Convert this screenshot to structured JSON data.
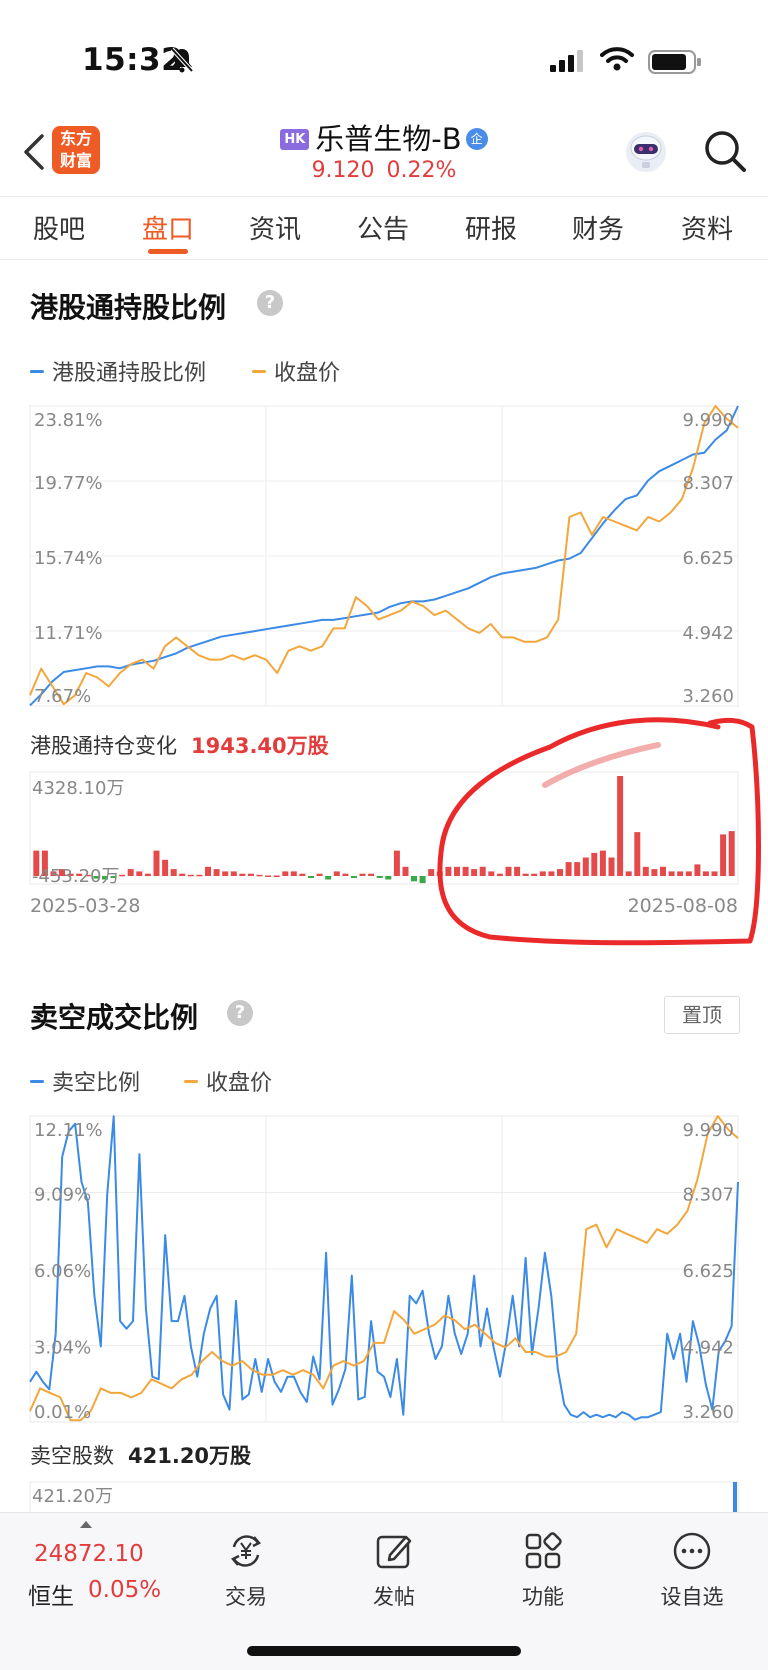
{
  "status_bar": {
    "time": "15:32"
  },
  "header": {
    "logo_text": "东方财富",
    "logo_line1": "东方",
    "logo_line2": "财富",
    "hk_badge": "HK",
    "stock_name": "乐普生物-B",
    "corp_badge": "企",
    "price": "9.120",
    "change_pct": "0.22%"
  },
  "tabs": [
    "股吧",
    "盘口",
    "资讯",
    "公告",
    "研报",
    "财务",
    "资料"
  ],
  "active_tab": 1,
  "section1": {
    "title": "港股通持股比例",
    "help": "?",
    "legend": [
      {
        "label": "港股通持股比例",
        "color": "#3b8ae6"
      },
      {
        "label": "收盘价",
        "color": "#f3a63b"
      }
    ],
    "y_left": [
      "23.81%",
      "19.77%",
      "15.74%",
      "11.71%",
      "7.67%"
    ],
    "y_right": [
      "9.990",
      "8.307",
      "6.625",
      "4.942",
      "3.260"
    ],
    "change_label": "港股通持仓变化",
    "change_value": "1943.40万股",
    "bar_max_label": "4328.10万",
    "bar_min_label": "-453.20万",
    "date_start": "2025-03-28",
    "date_end": "2025-08-08"
  },
  "section2": {
    "title": "卖空成交比例",
    "help": "?",
    "pin_button": "置顶",
    "legend": [
      {
        "label": "卖空比例",
        "color": "#3b8ae6"
      },
      {
        "label": "收盘价",
        "color": "#f3a63b"
      }
    ],
    "y_left": [
      "12.11%",
      "9.09%",
      "6.06%",
      "3.04%",
      "0.01%"
    ],
    "y_right": [
      "9.990",
      "8.307",
      "6.625",
      "4.942",
      "3.260"
    ],
    "shares_label": "卖空股数",
    "shares_value": "421.20万股",
    "bar_max_label": "421.20万"
  },
  "bottom_bar": {
    "index_value": "24872.10",
    "index_name": "恒生",
    "index_pct": "0.05%",
    "nav": [
      {
        "label": "交易",
        "icon": "yuan-exchange-icon"
      },
      {
        "label": "发帖",
        "icon": "edit-post-icon"
      },
      {
        "label": "功能",
        "icon": "grid-apps-icon"
      },
      {
        "label": "设自选",
        "icon": "more-dots-icon"
      }
    ]
  },
  "chart_data": [
    {
      "type": "line",
      "title": "港股通持股比例",
      "x_start": "2025-03-28",
      "x_end": "2025-08-08",
      "y_left_range": [
        7.67,
        23.81
      ],
      "y_right_range": [
        3.26,
        9.99
      ],
      "grid": true,
      "series": [
        {
          "name": "港股通持股比例",
          "axis": "left",
          "values": [
            7.7,
            8.3,
            9.0,
            9.5,
            9.6,
            9.7,
            9.8,
            9.8,
            9.7,
            9.9,
            10.0,
            10.1,
            10.3,
            10.5,
            10.8,
            11.0,
            11.2,
            11.4,
            11.5,
            11.6,
            11.7,
            11.8,
            11.9,
            12.0,
            12.1,
            12.2,
            12.3,
            12.3,
            12.4,
            12.5,
            12.6,
            12.7,
            13.0,
            13.2,
            13.3,
            13.3,
            13.4,
            13.6,
            13.8,
            14.0,
            14.3,
            14.6,
            14.8,
            14.9,
            15.0,
            15.1,
            15.3,
            15.5,
            15.6,
            15.9,
            16.7,
            17.5,
            18.2,
            18.8,
            19.0,
            19.8,
            20.3,
            20.6,
            20.9,
            21.2,
            21.3,
            22.0,
            22.5,
            23.81
          ]
        },
        {
          "name": "收盘价",
          "axis": "right",
          "values": [
            3.5,
            4.1,
            3.7,
            3.3,
            3.5,
            4.0,
            3.9,
            3.7,
            4.0,
            4.2,
            4.3,
            4.1,
            4.6,
            4.8,
            4.6,
            4.4,
            4.3,
            4.3,
            4.4,
            4.3,
            4.4,
            4.3,
            4.0,
            4.5,
            4.6,
            4.5,
            4.6,
            5.0,
            5.0,
            5.7,
            5.5,
            5.2,
            5.3,
            5.4,
            5.6,
            5.5,
            5.3,
            5.4,
            5.2,
            5.0,
            4.9,
            5.1,
            4.8,
            4.8,
            4.7,
            4.7,
            4.8,
            5.2,
            7.5,
            7.6,
            7.1,
            7.5,
            7.4,
            7.3,
            7.2,
            7.5,
            7.4,
            7.6,
            7.9,
            8.6,
            9.6,
            9.99,
            9.7,
            9.5
          ]
        }
      ]
    },
    {
      "type": "bar",
      "title": "港股通持仓变化",
      "ylim": [
        -453.2,
        4328.1
      ],
      "values": [
        1100,
        1100,
        200,
        300,
        100,
        100,
        50,
        -150,
        -200,
        -100,
        50,
        300,
        200,
        100,
        1100,
        700,
        300,
        100,
        50,
        50,
        400,
        300,
        200,
        200,
        100,
        100,
        50,
        20,
        20,
        200,
        200,
        100,
        -100,
        100,
        -200,
        200,
        100,
        -100,
        100,
        100,
        -100,
        -200,
        1100,
        400,
        -300,
        -400,
        300,
        200,
        400,
        400,
        400,
        300,
        400,
        200,
        100,
        400,
        400,
        100,
        100,
        200,
        200,
        300,
        600,
        600,
        800,
        1000,
        1100,
        800,
        4328,
        200,
        1900,
        400,
        300,
        400,
        200,
        200,
        200,
        500,
        200,
        200,
        1800,
        1943
      ]
    },
    {
      "type": "line",
      "title": "卖空成交比例",
      "y_left_range": [
        0.01,
        12.11
      ],
      "y_right_range": [
        3.26,
        9.99
      ],
      "grid": true,
      "series": [
        {
          "name": "卖空比例",
          "axis": "left",
          "values": [
            1.6,
            2.0,
            1.6,
            1.3,
            3.5,
            10.5,
            11.5,
            11.8,
            9.5,
            8.7,
            5.0,
            3.0,
            9.0,
            12.1,
            4.0,
            3.7,
            4.0,
            10.6,
            4.5,
            1.8,
            1.7,
            7.4,
            4.0,
            4.0,
            5.0,
            3.0,
            1.8,
            3.5,
            4.5,
            5.0,
            1.1,
            0.5,
            4.8,
            0.9,
            1.1,
            2.5,
            1.2,
            2.5,
            1.6,
            1.2,
            1.8,
            1.8,
            1.2,
            0.8,
            2.6,
            1.7,
            6.7,
            0.7,
            1.3,
            2.1,
            5.8,
            0.9,
            1.0,
            4.0,
            2.0,
            1.8,
            1.0,
            2.5,
            0.3,
            5.0,
            4.7,
            5.2,
            3.5,
            2.5,
            3.0,
            5.0,
            3.5,
            2.7,
            3.5,
            5.8,
            3.0,
            4.5,
            3.0,
            1.8,
            3.2,
            5.0,
            3.0,
            6.5,
            2.7,
            4.5,
            6.7,
            5.0,
            2.1,
            0.7,
            0.3,
            0.2,
            0.4,
            0.2,
            0.3,
            0.2,
            0.3,
            0.2,
            0.4,
            0.3,
            0.1,
            0.2,
            0.2,
            0.3,
            0.4,
            3.5,
            2.5,
            3.5,
            1.6,
            4.0,
            3.0,
            1.5,
            0.5,
            2.8,
            3.2,
            3.8,
            9.5
          ]
        },
        {
          "name": "收盘价",
          "axis": "right",
          "values": [
            3.5,
            4.0,
            3.9,
            3.8,
            3.3,
            3.3,
            3.5,
            4.0,
            3.9,
            3.9,
            3.8,
            3.9,
            4.2,
            4.1,
            4.0,
            4.2,
            4.3,
            4.6,
            4.8,
            4.6,
            4.5,
            4.6,
            4.4,
            4.3,
            4.3,
            4.4,
            4.3,
            4.4,
            4.3,
            4.0,
            4.5,
            4.6,
            4.5,
            4.6,
            5.0,
            5.0,
            5.7,
            5.5,
            5.2,
            5.3,
            5.4,
            5.6,
            5.5,
            5.3,
            5.4,
            5.2,
            5.0,
            4.9,
            5.1,
            4.8,
            4.8,
            4.7,
            4.7,
            4.8,
            5.2,
            7.5,
            7.6,
            7.1,
            7.5,
            7.4,
            7.3,
            7.2,
            7.5,
            7.4,
            7.6,
            7.9,
            8.6,
            9.6,
            9.99,
            9.7,
            9.5
          ]
        }
      ]
    },
    {
      "type": "bar",
      "title": "卖空股数",
      "ylim": [
        0,
        421.2
      ],
      "values": [
        421.2
      ]
    }
  ]
}
